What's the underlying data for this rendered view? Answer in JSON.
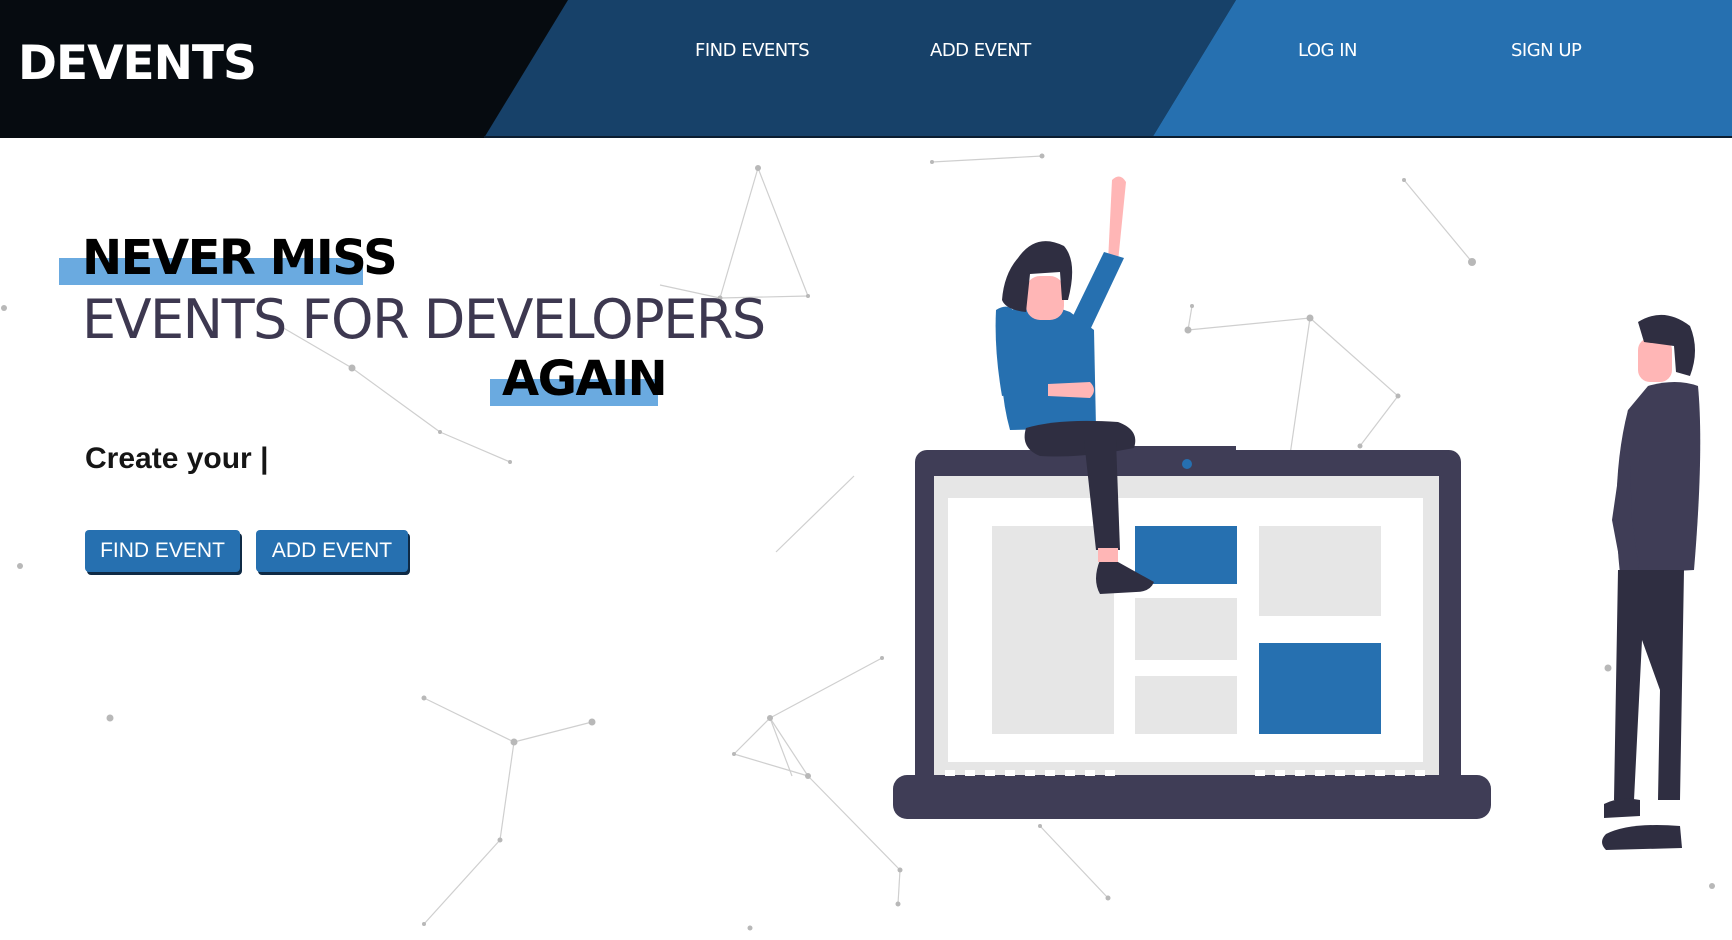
{
  "navbar": {
    "logo": "DEVENTS",
    "links": [
      {
        "label": "FIND EVENTS"
      },
      {
        "label": "ADD EVENT"
      },
      {
        "label": "LOG IN"
      },
      {
        "label": "SIGN UP"
      }
    ]
  },
  "hero": {
    "line1": "NEVER MISS",
    "line2": "EVENTS FOR DEVELOPERS",
    "line3": "AGAIN",
    "typed_text": "Create your |",
    "buttons": {
      "find": "FIND EVENT",
      "add": "ADD EVENT"
    }
  },
  "colors": {
    "nav_dark": "#060b10",
    "nav_mid": "#174169",
    "nav_light": "#2670b0",
    "accent": "#2670b0",
    "highlight": "#6aaae0"
  }
}
